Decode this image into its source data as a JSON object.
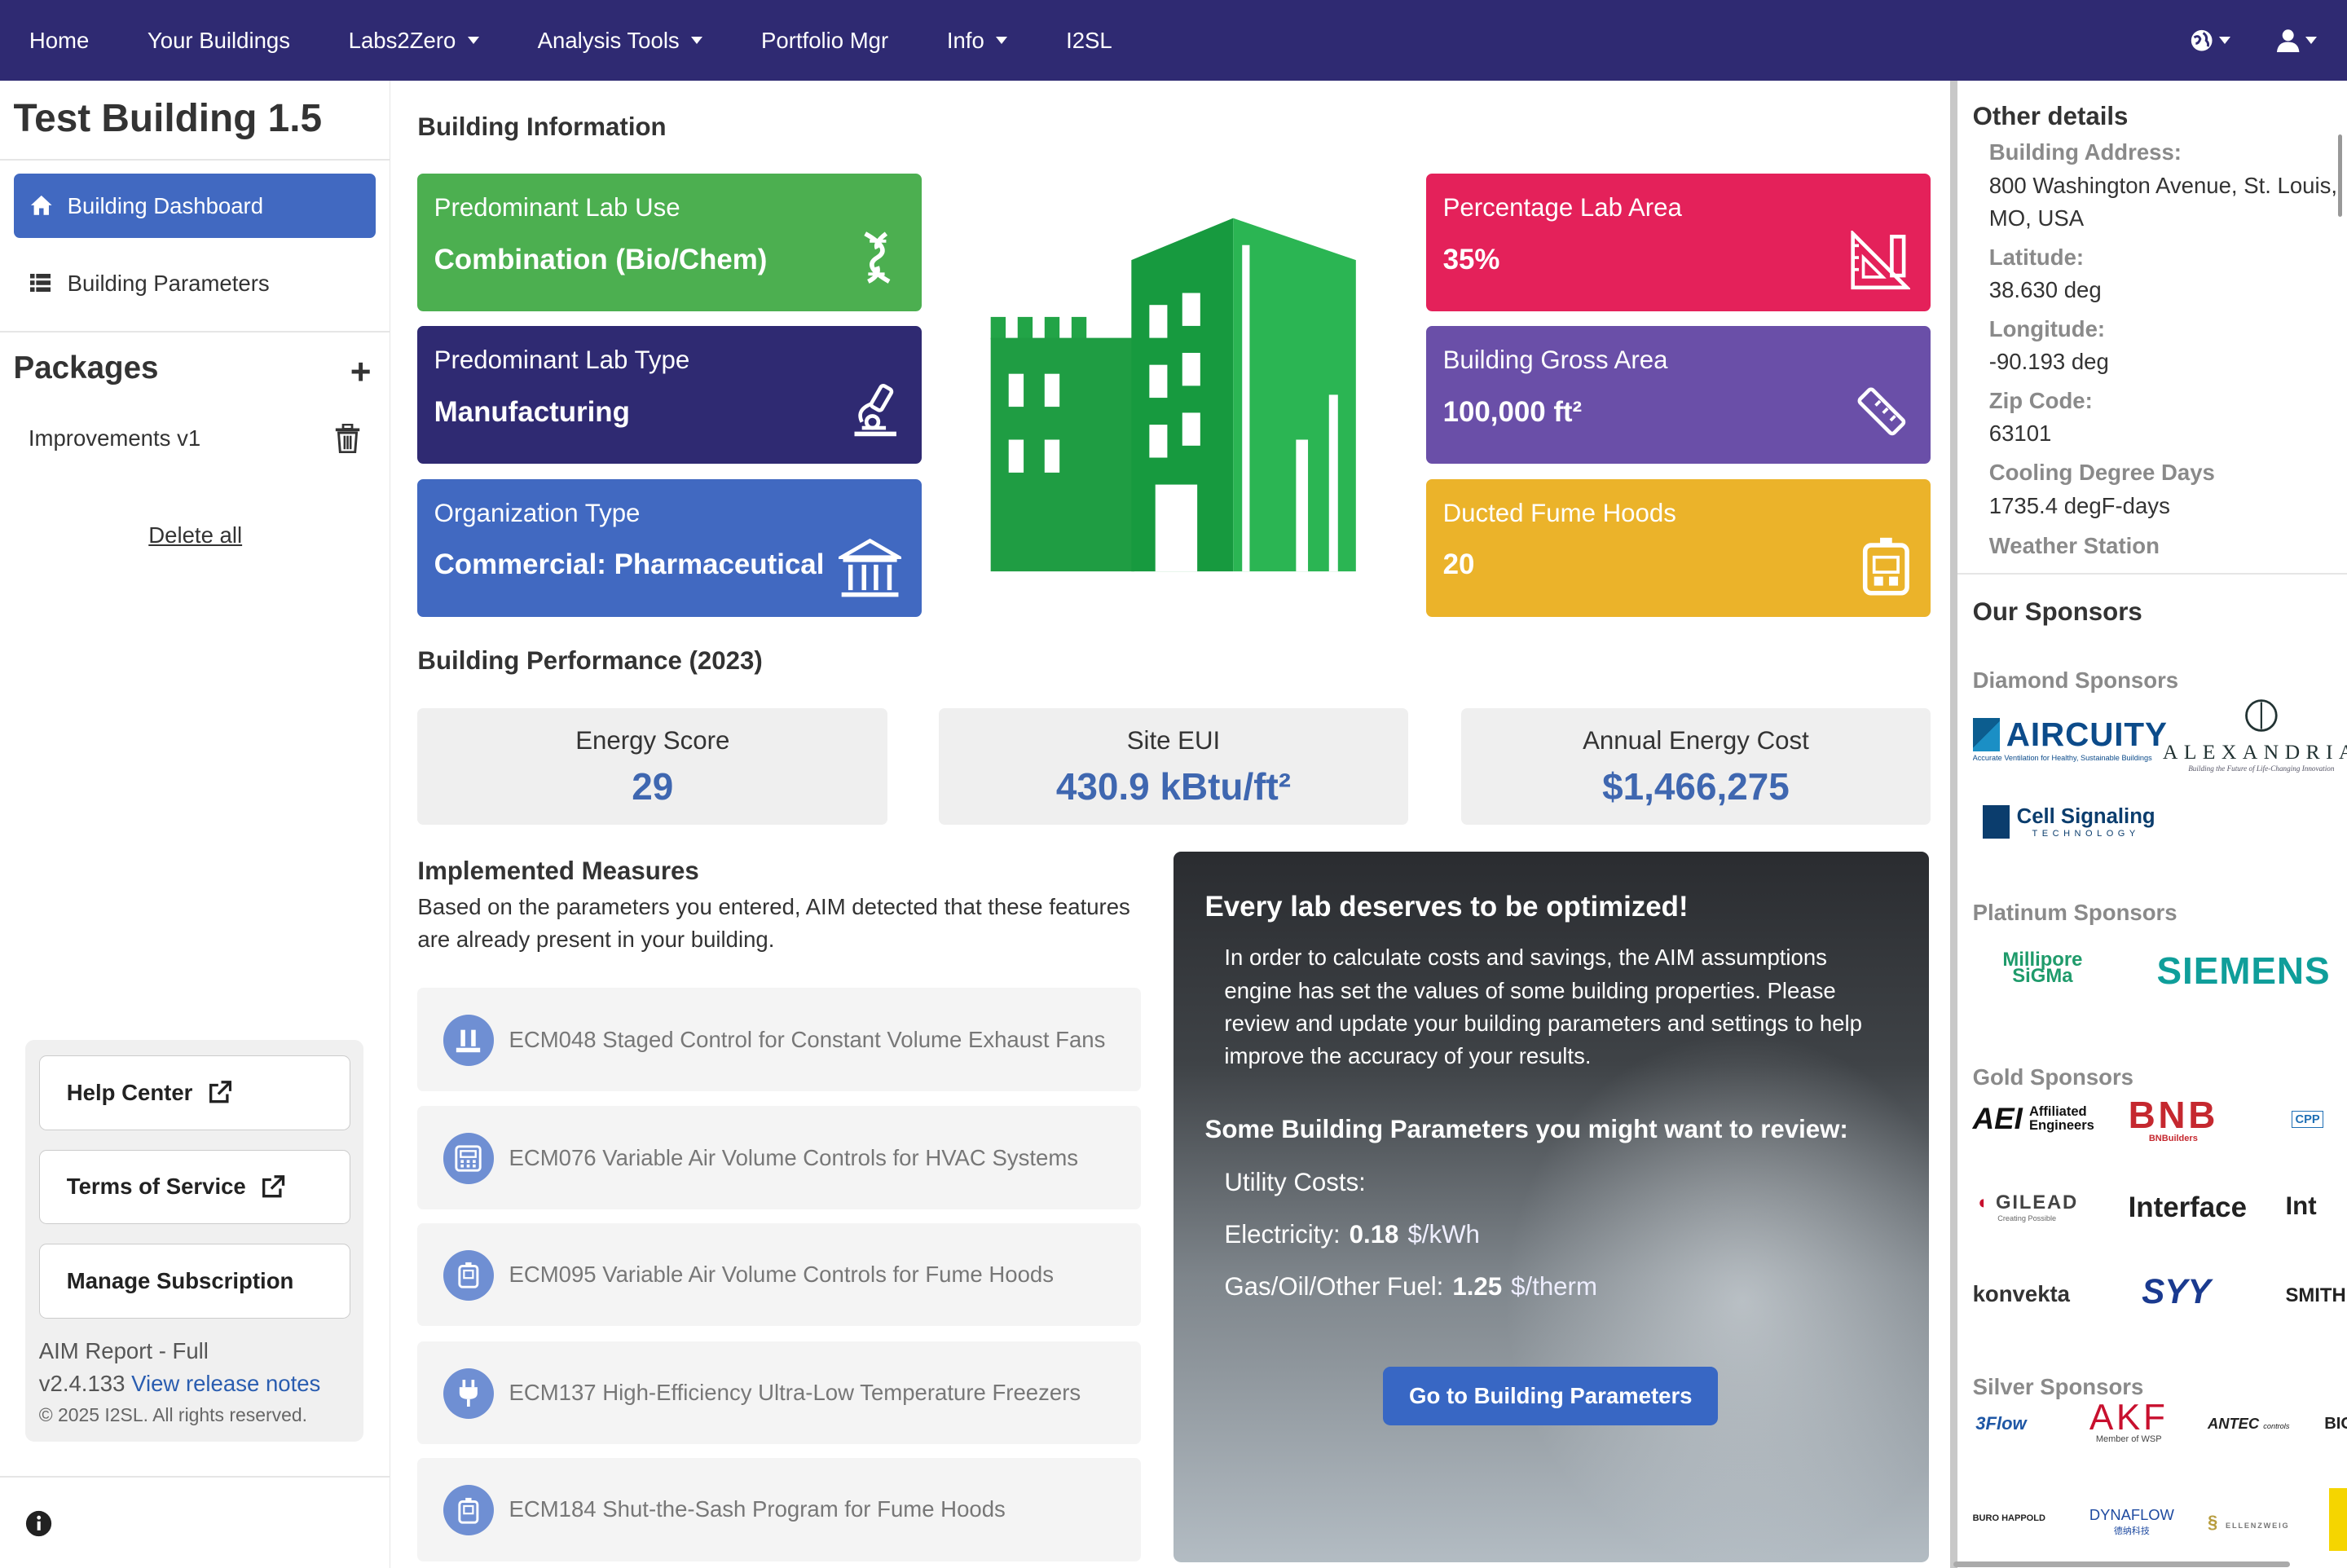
{
  "nav": {
    "items": [
      {
        "label": "Home",
        "dropdown": false
      },
      {
        "label": "Your Buildings",
        "dropdown": false
      },
      {
        "label": "Labs2Zero",
        "dropdown": true
      },
      {
        "label": "Analysis Tools",
        "dropdown": true
      },
      {
        "label": "Portfolio Mgr",
        "dropdown": false
      },
      {
        "label": "Info",
        "dropdown": true
      },
      {
        "label": "I2SL",
        "dropdown": false
      }
    ],
    "right_icons": [
      "globe-icon",
      "user-icon"
    ]
  },
  "sidebar": {
    "building_name": "Test Building 1.5",
    "menu": [
      {
        "label": "Building Dashboard",
        "icon": "home-icon",
        "active": true
      },
      {
        "label": "Building Parameters",
        "icon": "list-icon",
        "active": false
      }
    ],
    "packages_title": "Packages",
    "packages": [
      {
        "label": "Improvements v1"
      }
    ],
    "delete_all": "Delete all",
    "links": [
      {
        "label": "Help Center",
        "external": true
      },
      {
        "label": "Terms of Service",
        "external": true
      },
      {
        "label": "Manage Subscription",
        "external": false
      }
    ],
    "report": "AIM Report - Full",
    "version": "v2.4.133",
    "release_notes": "View release notes",
    "copyright": "© 2025 I2SL. All rights reserved."
  },
  "building_info": {
    "title": "Building Information",
    "cards_left": [
      {
        "label": "Predominant Lab Use",
        "value": "Combination (Bio/Chem)",
        "color": "#4caf50",
        "icon": "dna-icon"
      },
      {
        "label": "Predominant Lab Type",
        "value": "Manufacturing",
        "color": "#2f2a72",
        "icon": "microscope-icon"
      },
      {
        "label": "Organization Type",
        "value": "Commercial: Pharmaceutical",
        "color": "#4169c1",
        "icon": "building-columns-icon"
      }
    ],
    "cards_right": [
      {
        "label": "Percentage Lab Area",
        "value": "35%",
        "color": "#e4215a",
        "icon": "ruler-triangle-icon"
      },
      {
        "label": "Building Gross Area",
        "value": "100,000 ft²",
        "color": "#6a4fa8",
        "icon": "ruler-icon"
      },
      {
        "label": "Ducted Fume Hoods",
        "value": "20",
        "color": "#ebb32a",
        "icon": "fume-hood-icon"
      }
    ]
  },
  "performance": {
    "title": "Building Performance (2023)",
    "items": [
      {
        "label": "Energy Score",
        "value": "29"
      },
      {
        "label": "Site EUI",
        "value": "430.9 kBtu/ft²"
      },
      {
        "label": "Annual Energy Cost",
        "value": "$1,466,275"
      }
    ]
  },
  "measures": {
    "title": "Implemented Measures",
    "description": "Based on the parameters you entered, AIM detected that these features are already present in your building.",
    "items": [
      {
        "label": "ECM048 Staged Control for Constant Volume Exhaust Fans",
        "icon": "fan-stack-icon"
      },
      {
        "label": "ECM076 Variable Air Volume Controls for HVAC Systems",
        "icon": "control-panel-icon"
      },
      {
        "label": "ECM095 Variable Air Volume Controls for Fume Hoods",
        "icon": "fume-hood-icon"
      },
      {
        "label": "ECM137 High-Efficiency Ultra-Low Temperature Freezers",
        "icon": "plug-icon"
      },
      {
        "label": "ECM184 Shut-the-Sash Program for Fume Hoods",
        "icon": "fume-hood-icon"
      }
    ]
  },
  "promo": {
    "heading": "Every lab deserves to be optimized!",
    "body": "In order to calculate costs and savings, the AIM assumptions engine has set the values of some building properties. Please review and update your building parameters and settings to help improve the accuracy of your results.",
    "subheading": "Some Building Parameters you might want to review:",
    "utility_label": "Utility Costs:",
    "electricity_label": "Electricity:",
    "electricity_value": "0.18",
    "electricity_unit": "$/kWh",
    "fuel_label": "Gas/Oil/Other Fuel:",
    "fuel_value": "1.25",
    "fuel_unit": "$/therm",
    "button": "Go to Building Parameters"
  },
  "other_details": {
    "title": "Other details",
    "fields": [
      {
        "label": "Building Address:",
        "value": "800 Washington Avenue, St. Louis, MO, USA"
      },
      {
        "label": "Latitude:",
        "value": "38.630 deg"
      },
      {
        "label": "Longitude:",
        "value": "-90.193 deg"
      },
      {
        "label": "Zip Code:",
        "value": "63101"
      },
      {
        "label": "Cooling Degree Days",
        "value": "1735.4 degF-days"
      },
      {
        "label": "Weather Station",
        "value": ""
      }
    ]
  },
  "sponsors": {
    "title": "Our Sponsors",
    "tiers": [
      {
        "name": "Diamond Sponsors",
        "logos": [
          {
            "text": "AIRCUITY",
            "sub": "Accurate Ventilation for Healthy, Sustainable Buildings"
          },
          {
            "text": "ALEXANDRIA",
            "sub": "Building the Future of Life-Changing Innovation"
          },
          {
            "text": "Cell Signaling",
            "sub": "TECHNOLOGY"
          }
        ]
      },
      {
        "name": "Platinum Sponsors",
        "logos": [
          {
            "text": "Millipore",
            "sub": "SiGMa"
          },
          {
            "text": "SIEMENS",
            "sub": ""
          }
        ]
      },
      {
        "name": "Gold Sponsors",
        "logos": [
          {
            "text": "AEI",
            "sub": "Affiliated Engineers"
          },
          {
            "text": "BNB",
            "sub": "BNBuilders"
          },
          {
            "text": "CPP",
            "sub": ""
          },
          {
            "text": "GILEAD",
            "sub": "Creating Possible"
          },
          {
            "text": "Interface",
            "sub": ""
          },
          {
            "text": "Int",
            "sub": ""
          },
          {
            "text": "konvekta",
            "sub": ""
          },
          {
            "text": "SYY",
            "sub": ""
          },
          {
            "text": "SMITH",
            "sub": ""
          }
        ]
      },
      {
        "name": "Silver Sponsors",
        "logos": [
          {
            "text": "3Flow",
            "sub": ""
          },
          {
            "text": "AKF",
            "sub": "Member of WSP"
          },
          {
            "text": "ANTEC",
            "sub": "controls"
          },
          {
            "text": "BIG",
            "sub": ""
          },
          {
            "text": "BURO HAPPOLD",
            "sub": ""
          },
          {
            "text": "DYNAFLOW",
            "sub": "德纳科技"
          },
          {
            "text": "ELLENZWEIG",
            "sub": ""
          }
        ]
      }
    ]
  },
  "colors": {
    "nav": "#2f2a72",
    "accent": "#4169c1",
    "building_green": "#22a447"
  }
}
